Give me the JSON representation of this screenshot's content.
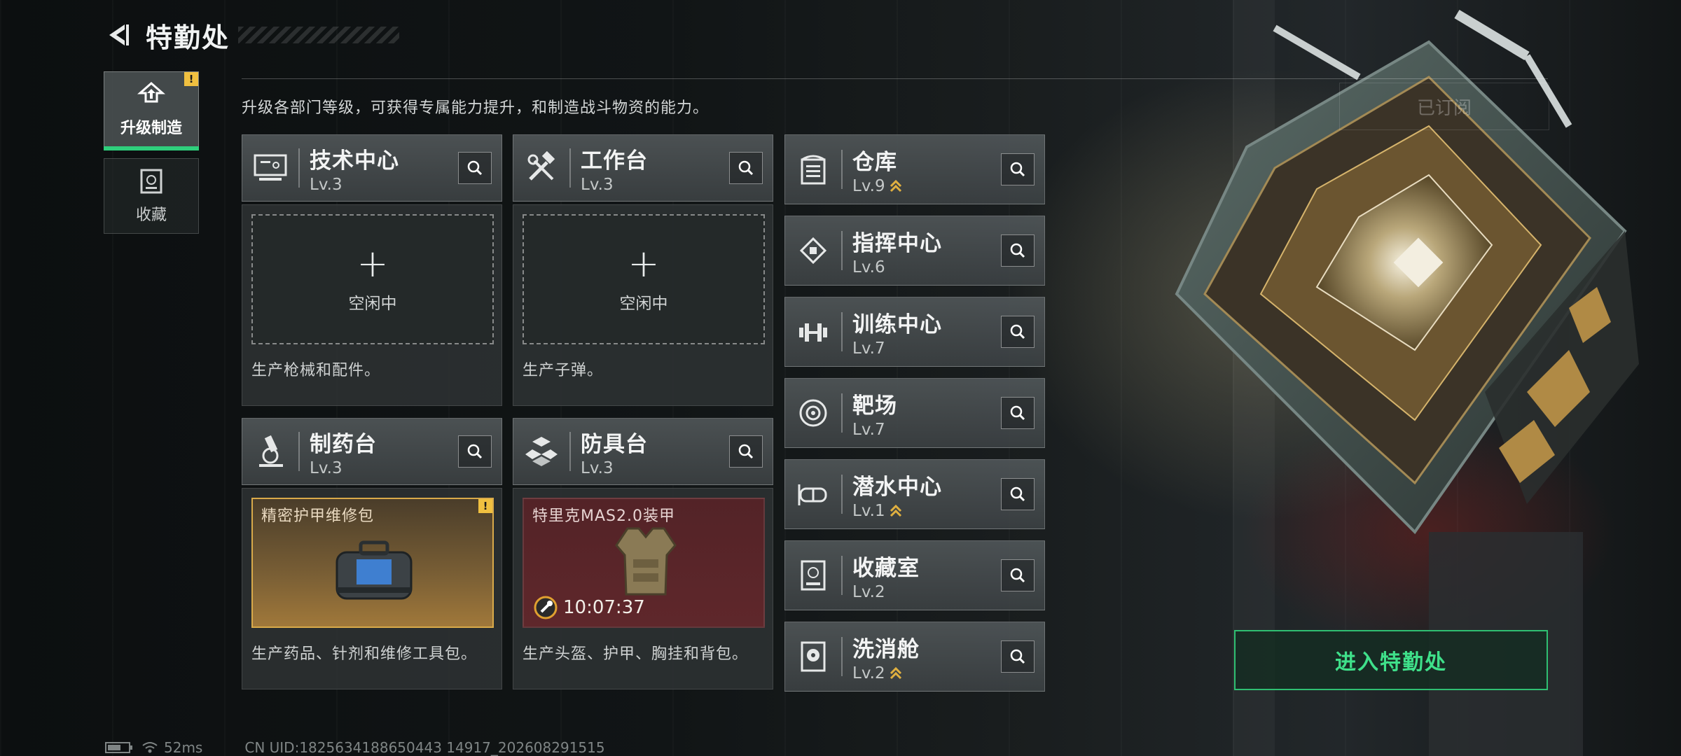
{
  "header": {
    "title": "特勤处"
  },
  "sidebar": {
    "items": [
      {
        "label": "升级制造",
        "badge": "!"
      },
      {
        "label": "收藏"
      }
    ]
  },
  "intro_text": "升级各部门等级，可获得专属能力提升，和制造战斗物资的能力。",
  "stations": {
    "tech_center": {
      "name": "技术中心",
      "level": "Lv.3"
    },
    "workbench": {
      "name": "工作台",
      "level": "Lv.3"
    },
    "pharmacy": {
      "name": "制药台",
      "level": "Lv.3"
    },
    "armor_bench": {
      "name": "防具台",
      "level": "Lv.3"
    }
  },
  "production": {
    "tech_center": {
      "plus": "+",
      "status": "空闲中",
      "desc": "生产枪械和配件。"
    },
    "workbench": {
      "plus": "+",
      "status": "空闲中",
      "desc": "生产子弹。"
    },
    "pharmacy": {
      "item": "精密护甲维修包",
      "badge": "!",
      "desc": "生产药品、针剂和维修工具包。"
    },
    "armor_bench": {
      "item": "特里克MAS2.0装甲",
      "timer": "10:07:37",
      "desc": "生产头盔、护甲、胸挂和背包。"
    }
  },
  "rooms": [
    {
      "name": "仓库",
      "level": "Lv.9",
      "upgradable": true
    },
    {
      "name": "指挥中心",
      "level": "Lv.6",
      "upgradable": false
    },
    {
      "name": "训练中心",
      "level": "Lv.7",
      "upgradable": false
    },
    {
      "name": "靶场",
      "level": "Lv.7",
      "upgradable": false
    },
    {
      "name": "潜水中心",
      "level": "Lv.1",
      "upgradable": true
    },
    {
      "name": "收藏室",
      "level": "Lv.2",
      "upgradable": false
    },
    {
      "name": "洗消舱",
      "level": "Lv.2",
      "upgradable": true
    }
  ],
  "right": {
    "subscribe_label": "已订阅",
    "enter_label": "进入特勤处"
  },
  "status": {
    "ping": "52ms",
    "uid": "CN UID:1825634188650443 14917_202608291515"
  },
  "colors": {
    "accent_green": "#2fcf7c",
    "alert_yellow": "#f0c040",
    "upgrade_gold": "#e0b040"
  }
}
